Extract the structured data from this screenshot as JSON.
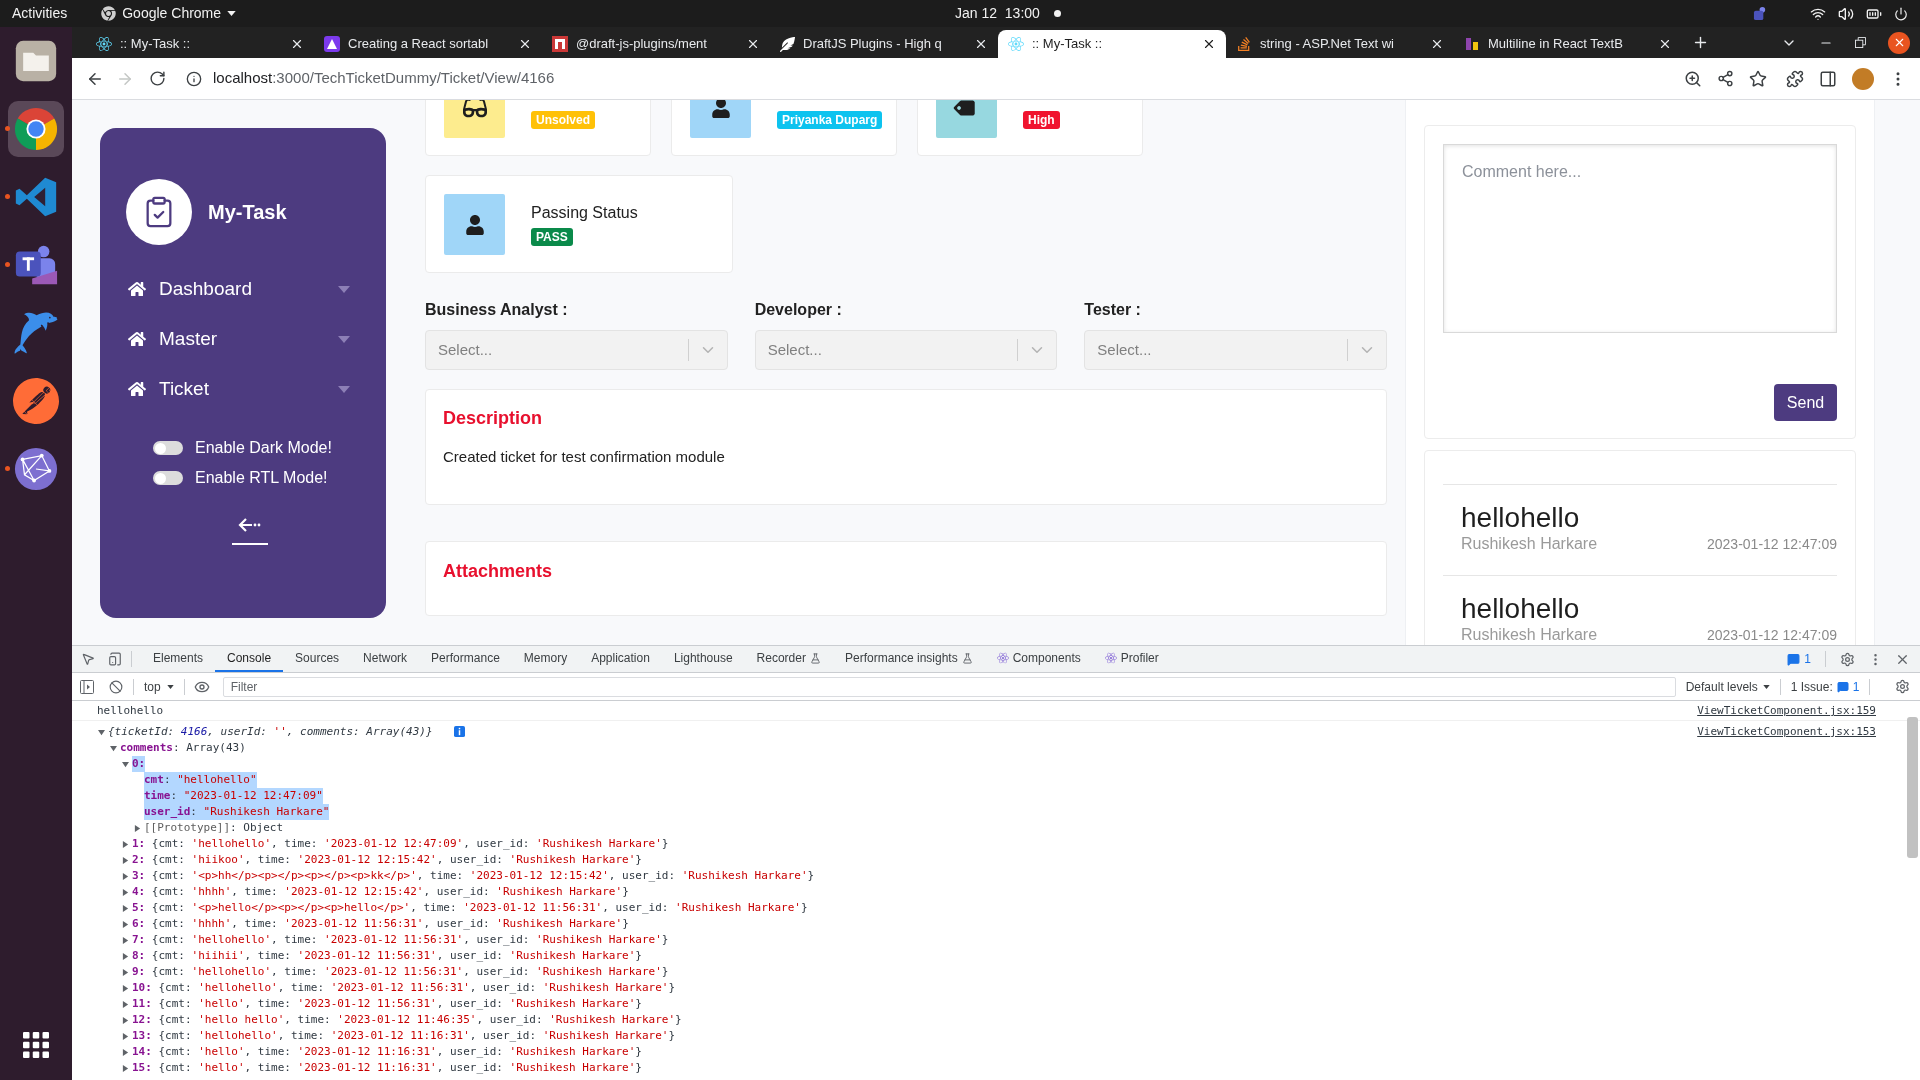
{
  "desktop_bar": {
    "activities": "Activities",
    "app_name": "Google Chrome",
    "clock": "Jan 12  13:00"
  },
  "dock": {
    "apps": [
      {
        "kind": "files",
        "running": false,
        "selected": false
      },
      {
        "kind": "browser",
        "running": true,
        "selected": true
      },
      {
        "kind": "editor",
        "running": true,
        "selected": false
      },
      {
        "kind": "chat",
        "running": true,
        "selected": false
      },
      {
        "kind": "dolphin",
        "running": false,
        "selected": false
      },
      {
        "kind": "astronaut",
        "running": false,
        "selected": false
      },
      {
        "kind": "globe",
        "running": true,
        "selected": false
      }
    ]
  },
  "browser": {
    "tabs": [
      {
        "title": ":: My-Task ::",
        "kind": "atom",
        "selected": false
      },
      {
        "title": "Creating a React sortabl",
        "kind": "triangle",
        "selected": false
      },
      {
        "title": "@draft-js-plugins/ment",
        "kind": "square",
        "selected": false
      },
      {
        "title": "DraftJS Plugins - High q",
        "kind": "feather",
        "selected": false
      },
      {
        "title": ":: My-Task ::",
        "kind": "atom",
        "selected": true
      },
      {
        "title": "string - ASP.Net Text wi",
        "kind": "stack",
        "selected": false
      },
      {
        "title": "Multiline in React TextB",
        "kind": "bars",
        "selected": false
      }
    ],
    "back": {
      "disabled": false
    },
    "forward": {
      "disabled": true
    },
    "url": {
      "host": "localhost",
      "path": ":3000/TechTicketDummy/Ticket/View/4166"
    }
  },
  "sidebar": {
    "brand": "My-Task",
    "menu": [
      {
        "label": "Dashboard"
      },
      {
        "label": "Master"
      },
      {
        "label": "Ticket"
      }
    ],
    "toggles": [
      {
        "label": "Enable Dark Mode!",
        "on": false
      },
      {
        "label": "Enable RTL Mode!",
        "on": false
      }
    ]
  },
  "summary_rows": [
    {
      "cards": [
        {
          "kind": "status",
          "badge": "Unsolved",
          "color": "#ffc107"
        },
        {
          "kind": "person",
          "badge": "Priyanka Duparg",
          "color": "#0dc3ef"
        },
        {
          "kind": "priority",
          "badge": "High",
          "color": "#f0142f"
        }
      ]
    },
    {
      "cards": [
        {
          "kind": "person",
          "title": "Passing Status",
          "badge": "PASS",
          "color": "#0a8a4a"
        }
      ]
    }
  ],
  "assignees": [
    {
      "label": "Business Analyst :",
      "placeholder": "Select..."
    },
    {
      "label": "Developer :",
      "placeholder": "Select..."
    },
    {
      "label": "Tester :",
      "placeholder": "Select..."
    }
  ],
  "description": {
    "title": "Description",
    "text": "Created ticket for test confirmation module"
  },
  "attachments": {
    "title": "Attachments"
  },
  "chat": {
    "placeholder": "Comment here...",
    "send_label": "Send",
    "comments": [
      {
        "text": "hellohello",
        "author": "Rushikesh Harkare",
        "time": "2023-01-12 12:47:09"
      },
      {
        "text": "hellohello",
        "author": "Rushikesh Harkare",
        "time": "2023-01-12 12:47:09"
      }
    ]
  },
  "devtools": {
    "tabs": [
      {
        "label": "Elements",
        "kind": "plain",
        "selected": false
      },
      {
        "label": "Console",
        "kind": "plain",
        "selected": true
      },
      {
        "label": "Sources",
        "kind": "plain",
        "selected": false
      },
      {
        "label": "Network",
        "kind": "plain",
        "selected": false
      },
      {
        "label": "Performance",
        "kind": "plain",
        "selected": false
      },
      {
        "label": "Memory",
        "kind": "plain",
        "selected": false
      },
      {
        "label": "Application",
        "kind": "plain",
        "selected": false
      },
      {
        "label": "Lighthouse",
        "kind": "plain",
        "selected": false
      },
      {
        "label": "Recorder",
        "kind": "experimental",
        "selected": false
      },
      {
        "label": "Performance insights",
        "kind": "experimental",
        "selected": false
      },
      {
        "label": "Components",
        "kind": "extension",
        "selected": false
      },
      {
        "label": "Profiler",
        "kind": "extension",
        "selected": false
      }
    ],
    "message_count": "1",
    "context": "top",
    "filter_placeholder": "Filter",
    "levels": "Default levels",
    "issues": {
      "label": "1 Issue:",
      "count": "1"
    },
    "messages": [
      {
        "kind": "log",
        "text": "hellohello",
        "source": "ViewTicketComponent.jsx:159"
      },
      {
        "kind": "object",
        "source": "ViewTicketComponent.jsx:153",
        "info": true,
        "tree": {
          "expanded": true,
          "highlighted": false,
          "segments": [
            {
              "kind": "plain",
              "text": "{ticketId: "
            },
            {
              "kind": "number",
              "text": "4166"
            },
            {
              "kind": "plain",
              "text": ", userId: "
            },
            {
              "kind": "string",
              "text": "''"
            },
            {
              "kind": "plain",
              "text": ", comments: Array(43)}"
            }
          ],
          "children": [
            {
              "expanded": true,
              "highlighted": false,
              "segments": [
                {
                  "kind": "key",
                  "text": "comments"
                },
                {
                  "kind": "plain",
                  "text": ": Array(43)"
                }
              ],
              "children": [
                {
                  "expanded": true,
                  "highlighted": true,
                  "segments": [
                    {
                      "kind": "key",
                      "text": "0:"
                    }
                  ],
                  "children": [
                    {
                      "highlighted": true,
                      "segments": [
                        {
                          "kind": "key",
                          "text": "cmt"
                        },
                        {
                          "kind": "plain",
                          "text": ": "
                        },
                        {
                          "kind": "string",
                          "text": "\"hellohello\""
                        }
                      ]
                    },
                    {
                      "highlighted": true,
                      "segments": [
                        {
                          "kind": "key",
                          "text": "time"
                        },
                        {
                          "kind": "plain",
                          "text": ": "
                        },
                        {
                          "kind": "string",
                          "text": "\"2023-01-12 12:47:09\""
                        }
                      ]
                    },
                    {
                      "highlighted": true,
                      "segments": [
                        {
                          "kind": "key",
                          "text": "user_id"
                        },
                        {
                          "kind": "plain",
                          "text": ": "
                        },
                        {
                          "kind": "string",
                          "text": "\"Rushikesh Harkare\""
                        }
                      ]
                    },
                    {
                      "expanded": false,
                      "highlighted": false,
                      "segments": [
                        {
                          "kind": "internal",
                          "text": "[[Prototype]]"
                        },
                        {
                          "kind": "plain",
                          "text": ": Object"
                        }
                      ]
                    }
                  ]
                },
                {
                  "expanded": false,
                  "highlighted": false,
                  "segments": [
                    {
                      "kind": "key",
                      "text": "1:"
                    },
                    {
                      "kind": "plain",
                      "text": " {cmt: "
                    },
                    {
                      "kind": "string",
                      "text": "'hellohello'"
                    },
                    {
                      "kind": "plain",
                      "text": ", time: "
                    },
                    {
                      "kind": "string",
                      "text": "'2023-01-12 12:47:09'"
                    },
                    {
                      "kind": "plain",
                      "text": ", user_id: "
                    },
                    {
                      "kind": "string",
                      "text": "'Rushikesh Harkare'"
                    },
                    {
                      "kind": "plain",
                      "text": "}"
                    }
                  ]
                },
                {
                  "expanded": false,
                  "highlighted": false,
                  "segments": [
                    {
                      "kind": "key",
                      "text": "2:"
                    },
                    {
                      "kind": "plain",
                      "text": " {cmt: "
                    },
                    {
                      "kind": "string",
                      "text": "'hiikoo'"
                    },
                    {
                      "kind": "plain",
                      "text": ", time: "
                    },
                    {
                      "kind": "string",
                      "text": "'2023-01-12 12:15:42'"
                    },
                    {
                      "kind": "plain",
                      "text": ", user_id: "
                    },
                    {
                      "kind": "string",
                      "text": "'Rushikesh Harkare'"
                    },
                    {
                      "kind": "plain",
                      "text": "}"
                    }
                  ]
                },
                {
                  "expanded": false,
                  "highlighted": false,
                  "segments": [
                    {
                      "kind": "key",
                      "text": "3:"
                    },
                    {
                      "kind": "plain",
                      "text": " {cmt: "
                    },
                    {
                      "kind": "string",
                      "text": "'<p>hh</p><p></p><p></p><p>kk</p>'"
                    },
                    {
                      "kind": "plain",
                      "text": ", time: "
                    },
                    {
                      "kind": "string",
                      "text": "'2023-01-12 12:15:42'"
                    },
                    {
                      "kind": "plain",
                      "text": ", user_id: "
                    },
                    {
                      "kind": "string",
                      "text": "'Rushikesh Harkare'"
                    },
                    {
                      "kind": "plain",
                      "text": "}"
                    }
                  ]
                },
                {
                  "expanded": false,
                  "highlighted": false,
                  "segments": [
                    {
                      "kind": "key",
                      "text": "4:"
                    },
                    {
                      "kind": "plain",
                      "text": " {cmt: "
                    },
                    {
                      "kind": "string",
                      "text": "'hhhh'"
                    },
                    {
                      "kind": "plain",
                      "text": ", time: "
                    },
                    {
                      "kind": "string",
                      "text": "'2023-01-12 12:15:42'"
                    },
                    {
                      "kind": "plain",
                      "text": ", user_id: "
                    },
                    {
                      "kind": "string",
                      "text": "'Rushikesh Harkare'"
                    },
                    {
                      "kind": "plain",
                      "text": "}"
                    }
                  ]
                },
                {
                  "expanded": false,
                  "highlighted": false,
                  "segments": [
                    {
                      "kind": "key",
                      "text": "5:"
                    },
                    {
                      "kind": "plain",
                      "text": " {cmt: "
                    },
                    {
                      "kind": "string",
                      "text": "'<p>hello</p><p></p><p>hello</p>'"
                    },
                    {
                      "kind": "plain",
                      "text": ", time: "
                    },
                    {
                      "kind": "string",
                      "text": "'2023-01-12 11:56:31'"
                    },
                    {
                      "kind": "plain",
                      "text": ", user_id: "
                    },
                    {
                      "kind": "string",
                      "text": "'Rushikesh Harkare'"
                    },
                    {
                      "kind": "plain",
                      "text": "}"
                    }
                  ]
                },
                {
                  "expanded": false,
                  "highlighted": false,
                  "segments": [
                    {
                      "kind": "key",
                      "text": "6:"
                    },
                    {
                      "kind": "plain",
                      "text": " {cmt: "
                    },
                    {
                      "kind": "string",
                      "text": "'hhhh'"
                    },
                    {
                      "kind": "plain",
                      "text": ", time: "
                    },
                    {
                      "kind": "string",
                      "text": "'2023-01-12 11:56:31'"
                    },
                    {
                      "kind": "plain",
                      "text": ", user_id: "
                    },
                    {
                      "kind": "string",
                      "text": "'Rushikesh Harkare'"
                    },
                    {
                      "kind": "plain",
                      "text": "}"
                    }
                  ]
                },
                {
                  "expanded": false,
                  "highlighted": false,
                  "segments": [
                    {
                      "kind": "key",
                      "text": "7:"
                    },
                    {
                      "kind": "plain",
                      "text": " {cmt: "
                    },
                    {
                      "kind": "string",
                      "text": "'hellohello'"
                    },
                    {
                      "kind": "plain",
                      "text": ", time: "
                    },
                    {
                      "kind": "string",
                      "text": "'2023-01-12 11:56:31'"
                    },
                    {
                      "kind": "plain",
                      "text": ", user_id: "
                    },
                    {
                      "kind": "string",
                      "text": "'Rushikesh Harkare'"
                    },
                    {
                      "kind": "plain",
                      "text": "}"
                    }
                  ]
                },
                {
                  "expanded": false,
                  "highlighted": false,
                  "segments": [
                    {
                      "kind": "key",
                      "text": "8:"
                    },
                    {
                      "kind": "plain",
                      "text": " {cmt: "
                    },
                    {
                      "kind": "string",
                      "text": "'hiihii'"
                    },
                    {
                      "kind": "plain",
                      "text": ", time: "
                    },
                    {
                      "kind": "string",
                      "text": "'2023-01-12 11:56:31'"
                    },
                    {
                      "kind": "plain",
                      "text": ", user_id: "
                    },
                    {
                      "kind": "string",
                      "text": "'Rushikesh Harkare'"
                    },
                    {
                      "kind": "plain",
                      "text": "}"
                    }
                  ]
                },
                {
                  "expanded": false,
                  "highlighted": false,
                  "segments": [
                    {
                      "kind": "key",
                      "text": "9:"
                    },
                    {
                      "kind": "plain",
                      "text": " {cmt: "
                    },
                    {
                      "kind": "string",
                      "text": "'hellohello'"
                    },
                    {
                      "kind": "plain",
                      "text": ", time: "
                    },
                    {
                      "kind": "string",
                      "text": "'2023-01-12 11:56:31'"
                    },
                    {
                      "kind": "plain",
                      "text": ", user_id: "
                    },
                    {
                      "kind": "string",
                      "text": "'Rushikesh Harkare'"
                    },
                    {
                      "kind": "plain",
                      "text": "}"
                    }
                  ]
                },
                {
                  "expanded": false,
                  "highlighted": false,
                  "segments": [
                    {
                      "kind": "key",
                      "text": "10:"
                    },
                    {
                      "kind": "plain",
                      "text": " {cmt: "
                    },
                    {
                      "kind": "string",
                      "text": "'hellohello'"
                    },
                    {
                      "kind": "plain",
                      "text": ", time: "
                    },
                    {
                      "kind": "string",
                      "text": "'2023-01-12 11:56:31'"
                    },
                    {
                      "kind": "plain",
                      "text": ", user_id: "
                    },
                    {
                      "kind": "string",
                      "text": "'Rushikesh Harkare'"
                    },
                    {
                      "kind": "plain",
                      "text": "}"
                    }
                  ]
                },
                {
                  "expanded": false,
                  "highlighted": false,
                  "segments": [
                    {
                      "kind": "key",
                      "text": "11:"
                    },
                    {
                      "kind": "plain",
                      "text": " {cmt: "
                    },
                    {
                      "kind": "string",
                      "text": "'hello'"
                    },
                    {
                      "kind": "plain",
                      "text": ", time: "
                    },
                    {
                      "kind": "string",
                      "text": "'2023-01-12 11:56:31'"
                    },
                    {
                      "kind": "plain",
                      "text": ", user_id: "
                    },
                    {
                      "kind": "string",
                      "text": "'Rushikesh Harkare'"
                    },
                    {
                      "kind": "plain",
                      "text": "}"
                    }
                  ]
                },
                {
                  "expanded": false,
                  "highlighted": false,
                  "segments": [
                    {
                      "kind": "key",
                      "text": "12:"
                    },
                    {
                      "kind": "plain",
                      "text": " {cmt: "
                    },
                    {
                      "kind": "string",
                      "text": "'hello hello'"
                    },
                    {
                      "kind": "plain",
                      "text": ", time: "
                    },
                    {
                      "kind": "string",
                      "text": "'2023-01-12 11:46:35'"
                    },
                    {
                      "kind": "plain",
                      "text": ", user_id: "
                    },
                    {
                      "kind": "string",
                      "text": "'Rushikesh Harkare'"
                    },
                    {
                      "kind": "plain",
                      "text": "}"
                    }
                  ]
                },
                {
                  "expanded": false,
                  "highlighted": false,
                  "segments": [
                    {
                      "kind": "key",
                      "text": "13:"
                    },
                    {
                      "kind": "plain",
                      "text": " {cmt: "
                    },
                    {
                      "kind": "string",
                      "text": "'hellohello'"
                    },
                    {
                      "kind": "plain",
                      "text": ", time: "
                    },
                    {
                      "kind": "string",
                      "text": "'2023-01-12 11:16:31'"
                    },
                    {
                      "kind": "plain",
                      "text": ", user_id: "
                    },
                    {
                      "kind": "string",
                      "text": "'Rushikesh Harkare'"
                    },
                    {
                      "kind": "plain",
                      "text": "}"
                    }
                  ]
                },
                {
                  "expanded": false,
                  "highlighted": false,
                  "segments": [
                    {
                      "kind": "key",
                      "text": "14:"
                    },
                    {
                      "kind": "plain",
                      "text": " {cmt: "
                    },
                    {
                      "kind": "string",
                      "text": "'hello'"
                    },
                    {
                      "kind": "plain",
                      "text": ", time: "
                    },
                    {
                      "kind": "string",
                      "text": "'2023-01-12 11:16:31'"
                    },
                    {
                      "kind": "plain",
                      "text": ", user_id: "
                    },
                    {
                      "kind": "string",
                      "text": "'Rushikesh Harkare'"
                    },
                    {
                      "kind": "plain",
                      "text": "}"
                    }
                  ]
                },
                {
                  "expanded": false,
                  "highlighted": false,
                  "segments": [
                    {
                      "kind": "key",
                      "text": "15:"
                    },
                    {
                      "kind": "plain",
                      "text": " {cmt: "
                    },
                    {
                      "kind": "string",
                      "text": "'hello'"
                    },
                    {
                      "kind": "plain",
                      "text": ", time: "
                    },
                    {
                      "kind": "string",
                      "text": "'2023-01-12 11:16:31'"
                    },
                    {
                      "kind": "plain",
                      "text": ", user_id: "
                    },
                    {
                      "kind": "string",
                      "text": "'Rushikesh Harkare'"
                    },
                    {
                      "kind": "plain",
                      "text": "}"
                    }
                  ]
                }
              ]
            }
          ]
        }
      }
    ]
  }
}
